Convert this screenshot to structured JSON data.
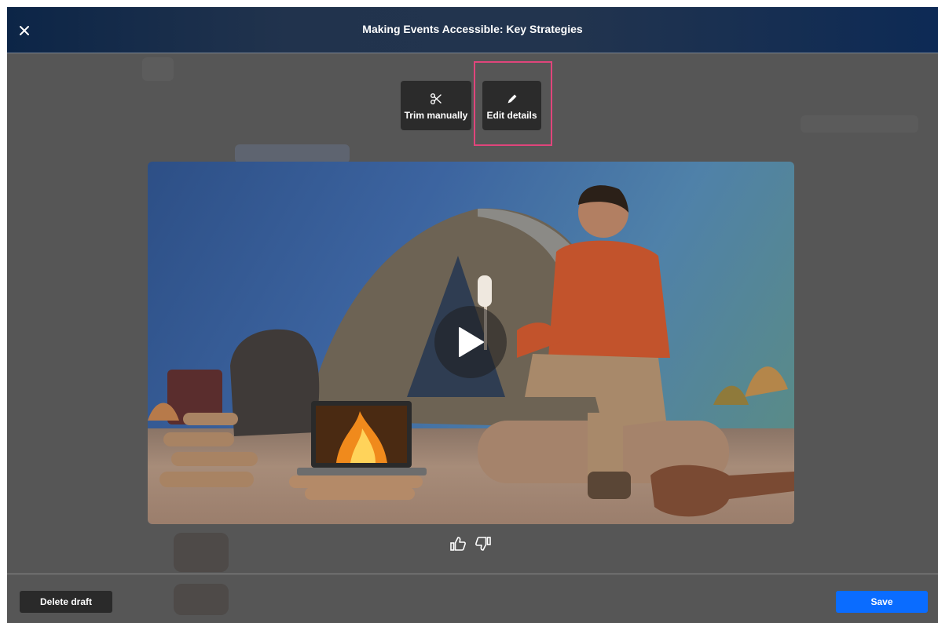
{
  "header": {
    "title": "Making Events Accessible: Key Strategies",
    "close_icon": "close-icon"
  },
  "toolbar": {
    "trim": {
      "label": "Trim manually",
      "icon": "scissors-icon"
    },
    "edit": {
      "label": "Edit details",
      "icon": "pencil-icon"
    }
  },
  "video": {
    "play_icon": "play-icon"
  },
  "feedback": {
    "up_icon": "thumbs-up-icon",
    "down_icon": "thumbs-down-icon"
  },
  "footer": {
    "delete_label": "Delete draft",
    "save_label": "Save"
  },
  "colors": {
    "accent": "#0a6cff",
    "highlight": "#e0457b",
    "header": "#1f3150",
    "overlay": "#565656"
  }
}
